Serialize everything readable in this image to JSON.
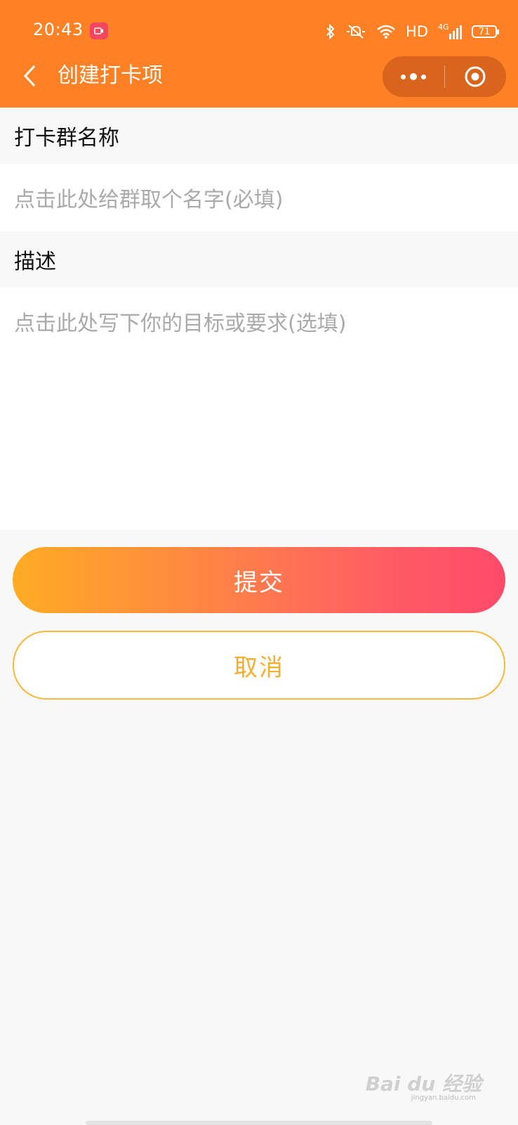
{
  "status_bar": {
    "time": "20:43",
    "network_label": "HD",
    "signal_label": "4G",
    "battery": "71"
  },
  "nav": {
    "title": "创建打卡项"
  },
  "form": {
    "group_name_label": "打卡群名称",
    "group_name_placeholder": "点击此处给群取个名字(必填)",
    "description_label": "描述",
    "description_placeholder": "点击此处写下你的目标或要求(选填)"
  },
  "actions": {
    "submit_label": "提交",
    "cancel_label": "取消"
  },
  "watermark": {
    "text": "Bai du 经验",
    "sub": "jingyan.baidu.com"
  },
  "colors": {
    "header": "#ff8126",
    "gradient_start": "#ffac24",
    "gradient_end": "#ff4a6a",
    "cancel_border": "#f5b93b"
  }
}
